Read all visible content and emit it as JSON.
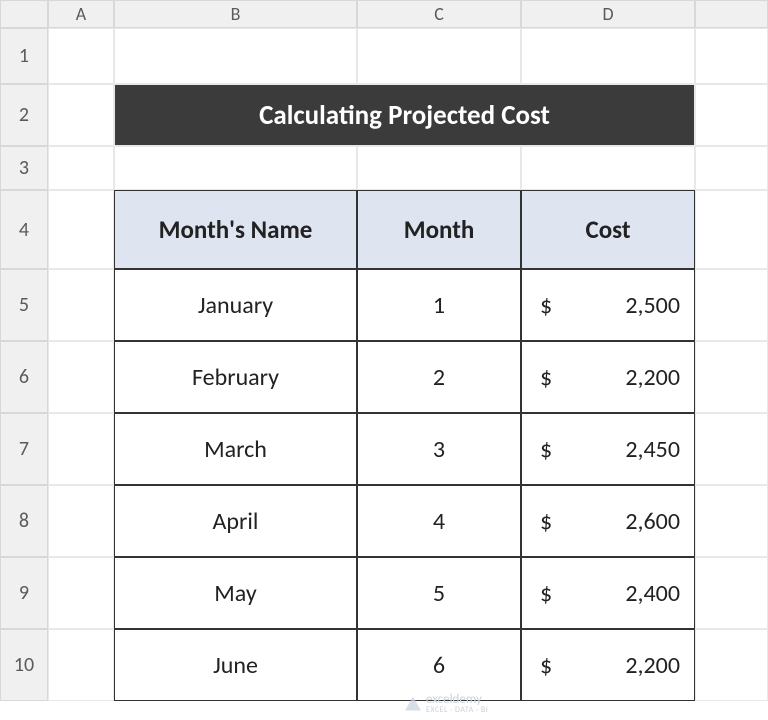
{
  "columns": [
    "A",
    "B",
    "C",
    "D"
  ],
  "rows": [
    "1",
    "2",
    "3",
    "4",
    "5",
    "6",
    "7",
    "8",
    "9",
    "10"
  ],
  "title": "Calculating Projected Cost",
  "headers": {
    "month_name": "Month's Name",
    "month": "Month",
    "cost": "Cost"
  },
  "data": [
    {
      "name": "January",
      "month": "1",
      "cost": "2,500"
    },
    {
      "name": "February",
      "month": "2",
      "cost": "2,200"
    },
    {
      "name": "March",
      "month": "3",
      "cost": "2,450"
    },
    {
      "name": "April",
      "month": "4",
      "cost": "2,600"
    },
    {
      "name": "May",
      "month": "5",
      "cost": "2,400"
    },
    {
      "name": "June",
      "month": "6",
      "cost": "2,200"
    }
  ],
  "currency_symbol": "$",
  "watermark": {
    "brand": "exceldemy",
    "tagline": "EXCEL · DATA · BI"
  }
}
